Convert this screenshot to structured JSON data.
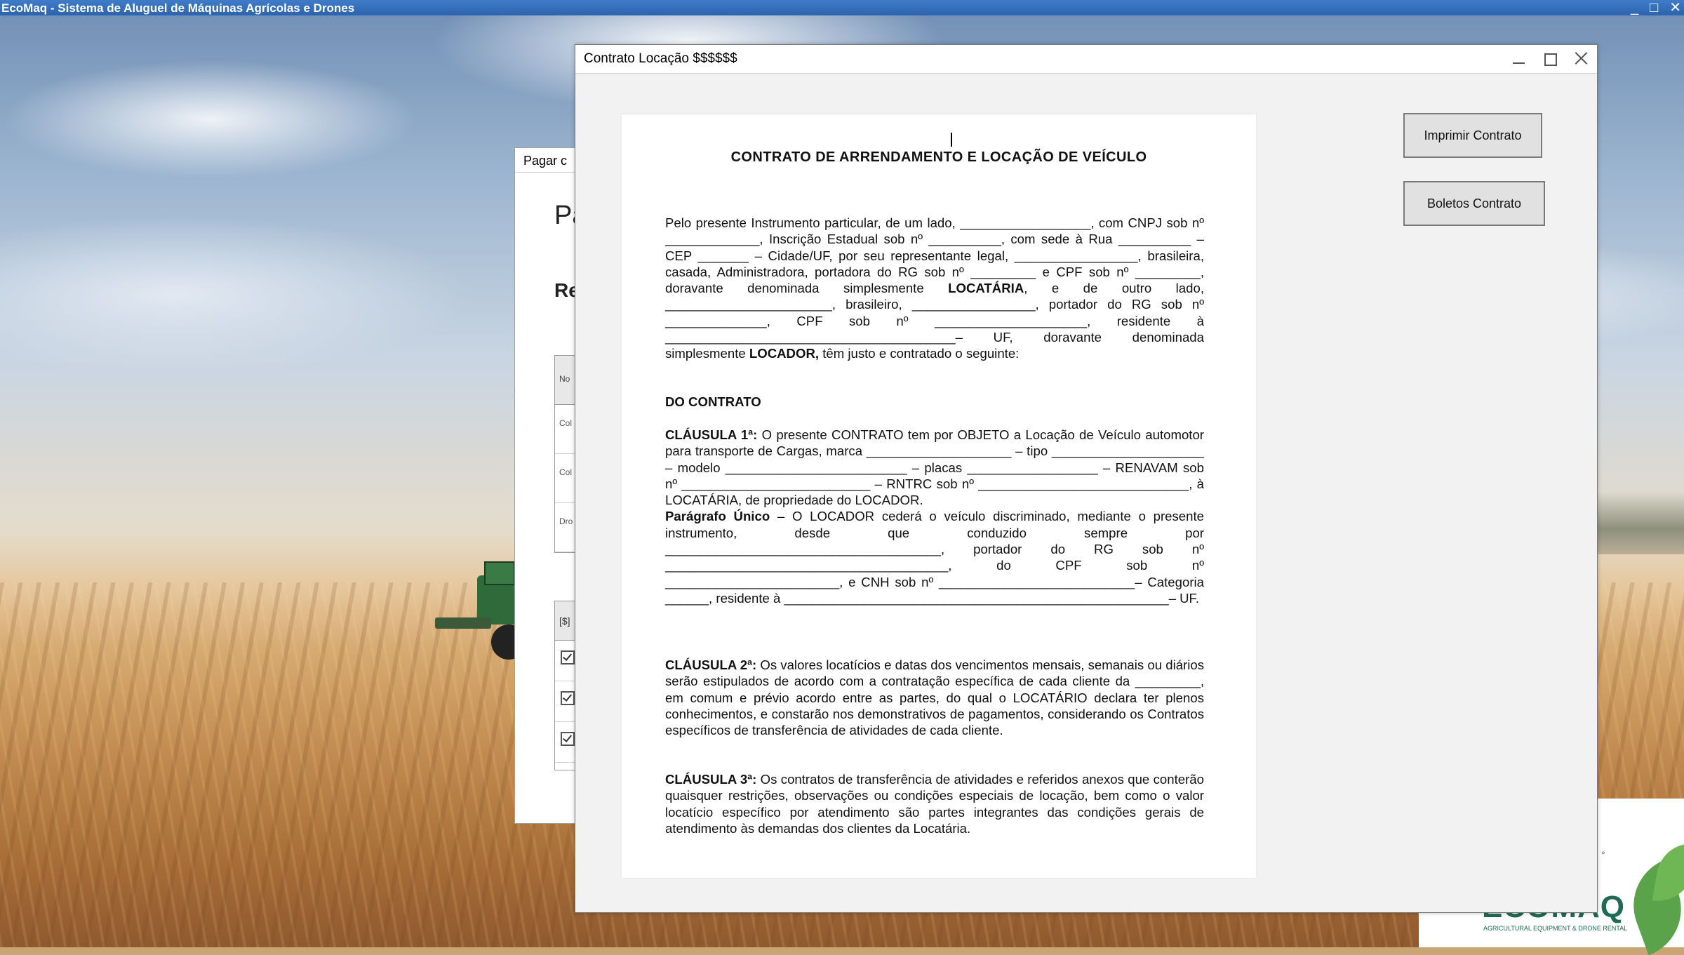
{
  "app": {
    "title": "EcoMaq - Sistema de Aluguel de Máquinas Agrícolas e Drones",
    "controls": {
      "minimize": "_",
      "maximize": "□",
      "close": "✕"
    }
  },
  "background_dialog": {
    "title": "Pagar c",
    "heading_partial": "Pa",
    "subheading_partial": "Re",
    "grid_header": "No",
    "grid_rows": [
      "Col Dre",
      "Col Ho",
      "Dro Vis"
    ],
    "grid2_header": "[$]"
  },
  "logo": {
    "name": "ECOMAQ",
    "tagline": "AGRICULTURAL EQUIPMENT & DRONE RENTAL"
  },
  "contract_window": {
    "title": "Contrato Locação $$$$$$",
    "buttons": {
      "print": "Imprimir Contrato",
      "boletos": "Boletos Contrato"
    },
    "document": {
      "heading": "CONTRATO DE ARRENDAMENTO E LOCAÇÃO DE VEÍCULO",
      "p1_a": "Pelo presente Instrumento particular, de um lado, __________________, com CNPJ sob nº _____________, Inscrição Estadual sob nº __________, com sede à Rua __________ – CEP _______ – Cidade/UF, por seu representante legal, _________________, brasileira, casada, Administradora, portadora do RG sob nº _________ e CPF sob nº _________, doravante denominada simplesmente ",
      "p1_locataria": "LOCATÁRIA",
      "p1_b": ", e de outro lado, _______________________, brasileiro, _________________, portador do RG sob nº ______________, CPF sob nº _____________________, residente à ________________________________________– UF, doravante denominada simplesmente ",
      "p1_locador": "LOCADOR,",
      "p1_c": " têm justo e contratado o seguinte:",
      "do_contrato": "DO CONTRATO",
      "c1_label": "CLÁUSULA 1ª:",
      "c1_a": " O presente CONTRATO tem por OBJETO a Locação de Veículo automotor para transporte de Cargas, marca ____________________ – tipo _____________________ – modelo _________________________ – placas __________________ – RENAVAM sob nº __________________________ – RNTRC sob nº _____________________________, à LOCATÁRIA, de propriedade do LOCADOR.",
      "pu_label": "Parágrafo Único",
      "pu_a": " – O LOCADOR cederá o veículo discriminado, mediante o presente instrumento, desde que conduzido sempre por ______________________________________, portador do RG sob nº _______________________________________, do CPF sob nº ________________________, e CNH sob nº ___________________________– Categoria ______, residente à _____________________________________________________– UF.",
      "c2_label": "CLÁUSULA 2ª:",
      "c2_a": " Os valores locatícios e datas dos vencimentos mensais, semanais ou diários serão estipulados de acordo com a contratação específica de cada cliente da _________, em comum e prévio acordo entre as partes, do qual o LOCATÁRIO declara ter plenos conhecimentos, e constarão nos demonstrativos de pagamentos, considerando os Contratos específicos de transferência de atividades de cada cliente.",
      "c3_label": "CLÁUSULA 3ª:",
      "c3_a": " Os contratos de transferência de atividades e referidos anexos que conterão quaisquer restrições, observações ou condições especiais de locação, bem como o valor locatício específico por atendimento são partes integrantes das condições gerais de atendimento às demandas dos clientes da Locatária."
    }
  }
}
